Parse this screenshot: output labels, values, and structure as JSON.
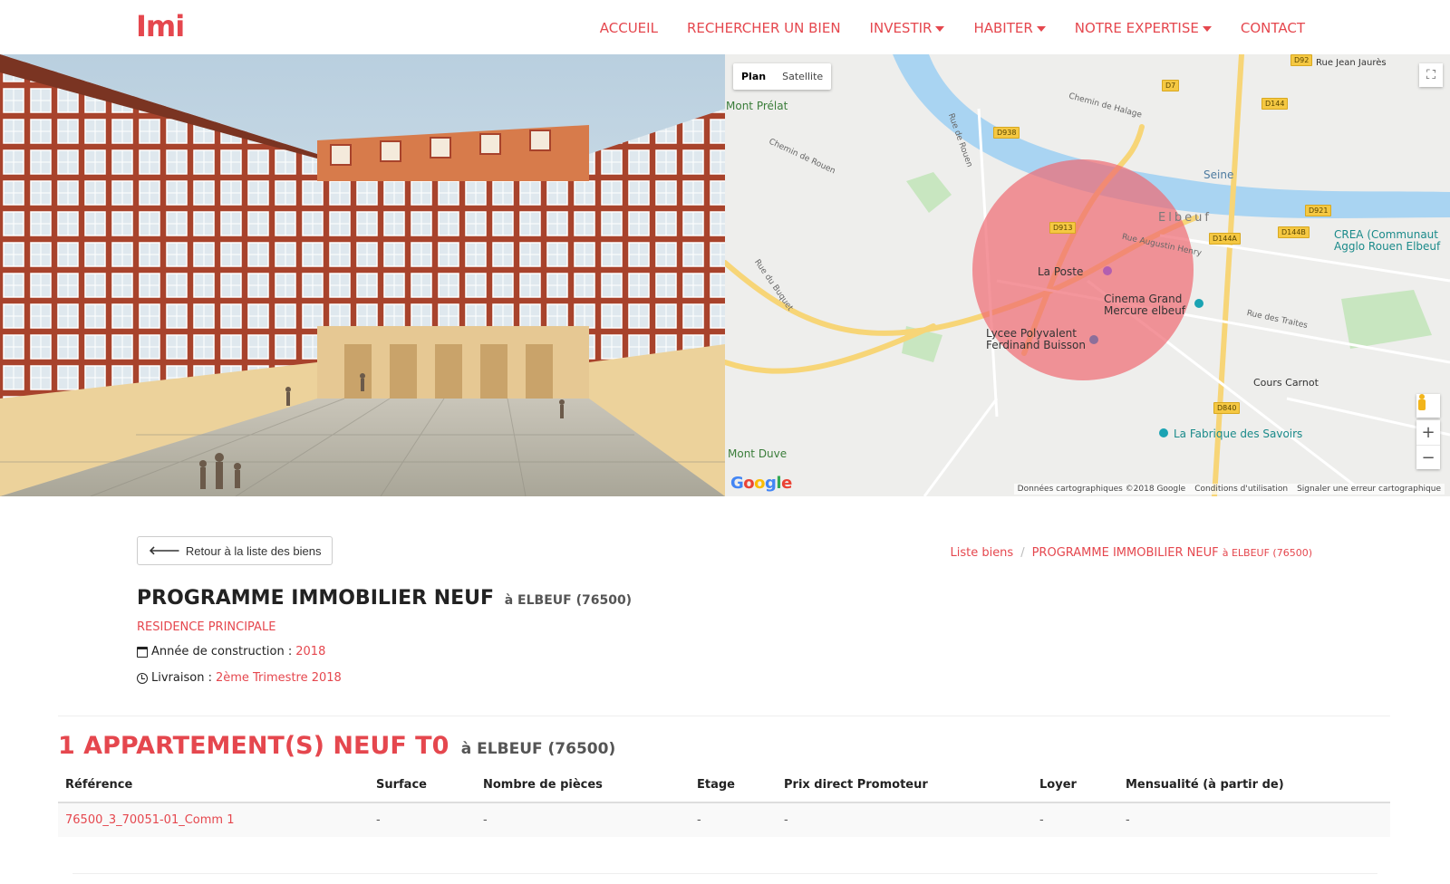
{
  "brand": {
    "logo": "Imi",
    "accent": "#e5474e"
  },
  "nav": {
    "items": [
      {
        "label": "ACCUEIL",
        "dropdown": false
      },
      {
        "label": "RECHERCHER UN BIEN",
        "dropdown": false
      },
      {
        "label": "INVESTIR",
        "dropdown": true
      },
      {
        "label": "HABITER",
        "dropdown": true
      },
      {
        "label": "NOTRE EXPERTISE",
        "dropdown": true
      },
      {
        "label": "CONTACT",
        "dropdown": false
      }
    ]
  },
  "map": {
    "type_buttons": {
      "plan": "Plan",
      "satellite": "Satellite",
      "active": "Plan"
    },
    "labels": {
      "mont_prelat": "Mont Prélat",
      "mont_duve": "Mont Duve",
      "seine": "Seine",
      "elbeuf": "Elbeuf",
      "la_poste": "La Poste",
      "cinema": "Cinema Grand Mercure elbeuf",
      "lycee": "Lycee Polyvalent Ferdinand Buisson",
      "crea": "CREA (Communaut Agglo Rouen Elbeuf",
      "cours_carnot": "Cours Carnot",
      "fabrique": "La Fabrique des Savoirs",
      "rue_jean_jaures": "Rue Jean Jaurès",
      "rue_de_rouen": "Rue de Rouen",
      "rue_du_buquet": "Rue du Buquet",
      "rue_augustin_henry": "Rue Augustin Henry",
      "rue_des_traites": "Rue des Traites",
      "chemin_de_halage": "Chemin de Halage",
      "chemin_de_rouen": "Chemin de Rouen"
    },
    "roads": [
      "D92",
      "D7",
      "D144",
      "D938",
      "D921",
      "D913",
      "D144A",
      "D144B",
      "D840"
    ],
    "footer": {
      "data": "Données cartographiques ©2018 Google",
      "terms": "Conditions d'utilisation",
      "report": "Signaler une erreur cartographique"
    },
    "google": "Google",
    "zoom_in": "+",
    "zoom_out": "−",
    "fullscreen_icon": "fullscreen-icon"
  },
  "actions": {
    "back": "Retour à la liste des biens"
  },
  "breadcrumb": {
    "list": "Liste biens",
    "current": "PROGRAMME IMMOBILIER NEUF",
    "current_loc": "à ELBEUF (76500)"
  },
  "program": {
    "title": "PROGRAMME IMMOBILIER NEUF",
    "location": "à ELBEUF (76500)",
    "type": "RESIDENCE PRINCIPALE",
    "construction_label": "Année de construction :",
    "construction_year": "2018",
    "delivery_label": "Livraison :",
    "delivery_value": "2ème Trimestre 2018"
  },
  "section": {
    "title": "1 APPARTEMENT(S) NEUF T0",
    "location": "à ELBEUF (76500)"
  },
  "table": {
    "headers": [
      "Référence",
      "Surface",
      "Nombre de pièces",
      "Etage",
      "Prix direct Promoteur",
      "Loyer",
      "Mensualité (à partir de)"
    ],
    "rows": [
      [
        "76500_3_70051-01_Comm 1",
        "-",
        "-",
        "-",
        "-",
        "-",
        "-"
      ]
    ]
  }
}
